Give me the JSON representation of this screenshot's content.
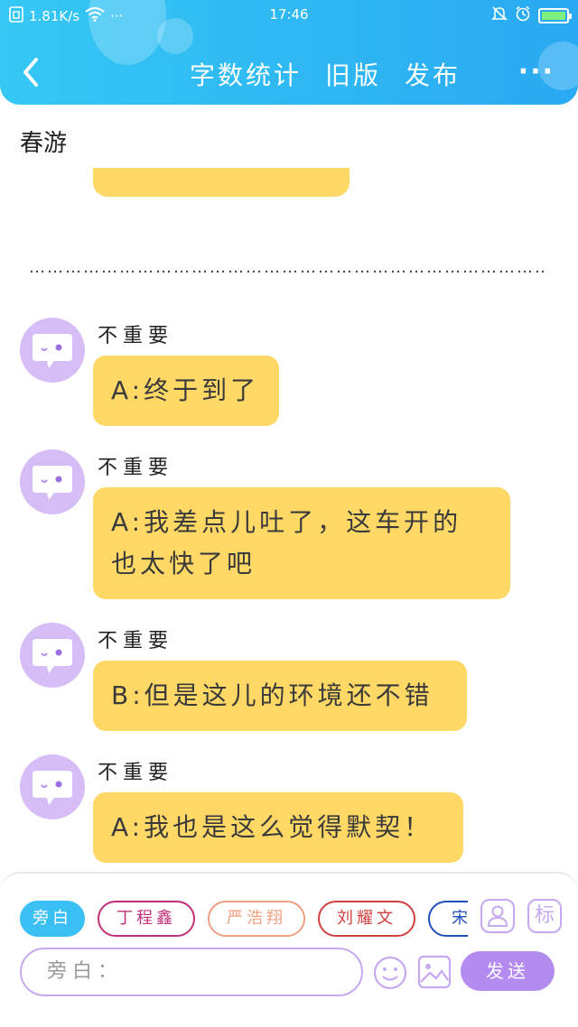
{
  "status_bar": {
    "speed": "1.81K/s",
    "more": "···",
    "time": "17:46"
  },
  "nav": {
    "word_count": "字数统计",
    "old_version": "旧版",
    "publish": "发布",
    "more": "···"
  },
  "story": {
    "title": "春游"
  },
  "chat": {
    "ellipsis": "……………………………………………………………………………………",
    "messages": [
      {
        "speaker": "不重要",
        "lines": [
          "A:终于到了"
        ]
      },
      {
        "speaker": "不重要",
        "lines": [
          "A:我差点儿吐了，这车开的",
          "也太快了吧"
        ]
      },
      {
        "speaker": "不重要",
        "lines": [
          "B:但是这儿的环境还不错"
        ]
      },
      {
        "speaker": "不重要",
        "lines": [
          "A:我也是这么觉得默契！"
        ]
      }
    ]
  },
  "roles": [
    {
      "label": "旁白",
      "color": "#3ac0f5"
    },
    {
      "label": "丁程鑫",
      "color": "#c0307a"
    },
    {
      "label": "严浩翔",
      "color": "#f0a080"
    },
    {
      "label": "刘耀文",
      "color": "#d04040"
    },
    {
      "label": "宋",
      "color": "#2050c0"
    }
  ],
  "toolbar": {
    "label_icon_text": "标"
  },
  "composer": {
    "placeholder": "旁白：",
    "send_label": "发送"
  },
  "colors": {
    "header": "#29a9f2",
    "bubble": "#ffd866",
    "avatar": "#d6bdf5",
    "accent": "#b48cf0"
  }
}
